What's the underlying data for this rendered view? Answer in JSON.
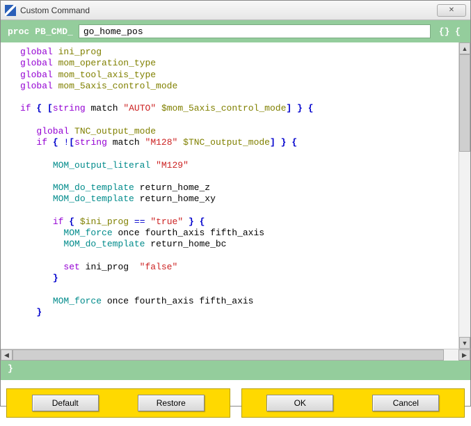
{
  "window": {
    "title": "Custom Command"
  },
  "header": {
    "proc_label": "proc",
    "prefix_label": "PB_CMD_",
    "cmd_name": "go_home_pos",
    "open_braces": "{} {"
  },
  "footer": {
    "close_brace": "}"
  },
  "buttons": {
    "default": "Default",
    "restore": "Restore",
    "ok": "OK",
    "cancel": "Cancel"
  },
  "code": {
    "l01a": "global",
    "l01b": "ini_prog",
    "l02a": "global",
    "l02b": "mom_operation_type",
    "l03a": "global",
    "l03b": "mom_tool_axis_type",
    "l04a": "global",
    "l04b": "mom_5axis_control_mode",
    "l06a": "if",
    "l06b": "{",
    "l06c": "[",
    "l06d": "string",
    "l06e": "match",
    "l06f": "\"AUTO\"",
    "l06g": "$mom_5axis_control_mode",
    "l06h": "]",
    "l06i": "}",
    "l06j": "{",
    "l08a": "global",
    "l08b": "TNC_output_mode",
    "l09a": "if",
    "l09b": "{",
    "l09c": "!",
    "l09d": "[",
    "l09e": "string",
    "l09f": "match",
    "l09g": "\"M128\"",
    "l09h": "$TNC_output_mode",
    "l09i": "]",
    "l09j": "}",
    "l09k": "{",
    "l11a": "MOM_output_literal",
    "l11b": "\"M129\"",
    "l13a": "MOM_do_template",
    "l13b": "return_home_z",
    "l14a": "MOM_do_template",
    "l14b": "return_home_xy",
    "l16a": "if",
    "l16b": "{",
    "l16c": "$ini_prog",
    "l16d": "==",
    "l16e": "\"true\"",
    "l16f": "}",
    "l16g": "{",
    "l17a": "MOM_force",
    "l17b": "once fourth_axis fifth_axis",
    "l18a": "MOM_do_template",
    "l18b": "return_home_bc",
    "l20a": "set",
    "l20b": "ini_prog",
    "l20c": "\"false\"",
    "l21a": "}",
    "l23a": "MOM_force",
    "l23b": "once fourth_axis fifth_axis",
    "l24a": "}"
  }
}
